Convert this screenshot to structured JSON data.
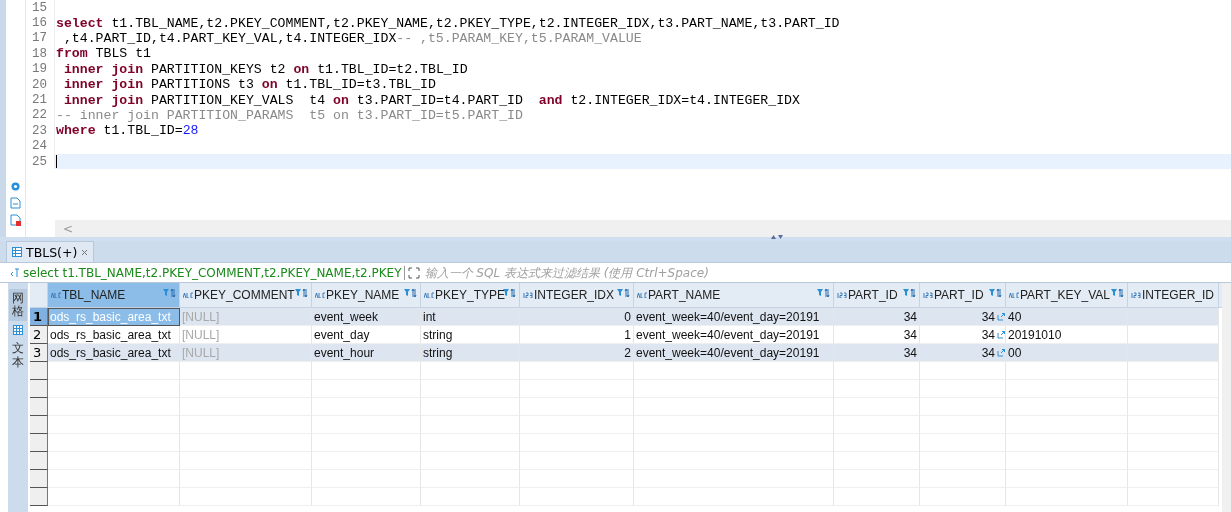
{
  "editor": {
    "lines": [
      {
        "number": "15",
        "current": false
      },
      {
        "number": "16",
        "current": false,
        "tokens": [
          {
            "kind": "keyword",
            "text": "select"
          },
          {
            "kind": "plain",
            "text": " t1.TBL_NAME,t2.PKEY_COMMENT,t2.PKEY_NAME,t2.PKEY_TYPE,t2.INTEGER_IDX,t3.PART_NAME,t3.PART_ID"
          }
        ]
      },
      {
        "number": "17",
        "current": false,
        "tokens": [
          {
            "kind": "plain",
            "text": " ,t4.PART_ID,t4.PART_KEY_VAL,t4.INTEGER_IDX"
          },
          {
            "kind": "comment",
            "text": "-- ,t5.PARAM_KEY,t5.PARAM_VALUE"
          }
        ]
      },
      {
        "number": "18",
        "current": false,
        "tokens": [
          {
            "kind": "keyword",
            "text": "from"
          },
          {
            "kind": "plain",
            "text": " TBLS t1"
          }
        ]
      },
      {
        "number": "19",
        "current": false,
        "tokens": [
          {
            "kind": "keyword",
            "text": " inner join"
          },
          {
            "kind": "plain",
            "text": " PARTITION_KEYS t2 "
          },
          {
            "kind": "keyword",
            "text": "on"
          },
          {
            "kind": "plain",
            "text": " t1.TBL_ID=t2.TBL_ID"
          }
        ]
      },
      {
        "number": "20",
        "current": false,
        "tokens": [
          {
            "kind": "keyword",
            "text": " inner join"
          },
          {
            "kind": "plain",
            "text": " PARTITIONS t3 "
          },
          {
            "kind": "keyword",
            "text": "on"
          },
          {
            "kind": "plain",
            "text": " t1.TBL_ID=t3.TBL_ID"
          }
        ]
      },
      {
        "number": "21",
        "current": false,
        "tokens": [
          {
            "kind": "keyword",
            "text": " inner join"
          },
          {
            "kind": "plain",
            "text": " PARTITION_KEY_VALS  t4 "
          },
          {
            "kind": "keyword",
            "text": "on"
          },
          {
            "kind": "plain",
            "text": " t3.PART_ID=t4.PART_ID  "
          },
          {
            "kind": "keyword",
            "text": "and"
          },
          {
            "kind": "plain",
            "text": " t2.INTEGER_IDX=t4.INTEGER_IDX"
          }
        ]
      },
      {
        "number": "22",
        "current": false,
        "tokens": [
          {
            "kind": "comment",
            "text": "-- inner join PARTITION_PARAMS  t5 on t3.PART_ID=t5.PART_ID"
          }
        ]
      },
      {
        "number": "23",
        "current": false,
        "tokens": [
          {
            "kind": "keyword",
            "text": "where"
          },
          {
            "kind": "plain",
            "text": " t1.TBL_ID="
          },
          {
            "kind": "number",
            "text": "28"
          }
        ]
      },
      {
        "number": "24",
        "current": false
      },
      {
        "number": "25",
        "current": true
      }
    ],
    "scroll_left": "<"
  },
  "results": {
    "tab": {
      "label": "TBLS(+)",
      "selected": true
    },
    "query": "select t1.TBL_NAME,t2.PKEY_COMMENT,t2.PKEY_NAME,t2.PKEY",
    "filter": {
      "placeholder": "输入一个 SQL 表达式来过滤结果 (使用 Ctrl+Space)"
    },
    "side_tabs": [
      {
        "label": "网格",
        "selected": true
      },
      {
        "label": "文本",
        "selected": false
      }
    ],
    "columns": [
      {
        "label": "TBL_NAME",
        "kind": "text",
        "link": false,
        "selected": true
      },
      {
        "label": "PKEY_COMMENT",
        "kind": "text",
        "link": false,
        "selected": false
      },
      {
        "label": "PKEY_NAME",
        "kind": "text",
        "link": false,
        "selected": false
      },
      {
        "label": "PKEY_TYPE",
        "kind": "text",
        "link": false,
        "selected": false
      },
      {
        "label": "INTEGER_IDX",
        "kind": "number",
        "link": false,
        "selected": false
      },
      {
        "label": "PART_NAME",
        "kind": "text",
        "link": false,
        "selected": false
      },
      {
        "label": "PART_ID",
        "kind": "number",
        "link": false,
        "selected": false
      },
      {
        "label": "PART_ID",
        "kind": "number",
        "link": true,
        "selected": false
      },
      {
        "label": "PART_KEY_VAL",
        "kind": "text",
        "link": false,
        "selected": false
      },
      {
        "label": "INTEGER_ID",
        "kind": "number",
        "link": false,
        "selected": false
      }
    ],
    "rows": [
      {
        "number": "1",
        "selected": true,
        "cells": [
          "ods_rs_basic_area_txt",
          "[NULL]",
          "event_week",
          "int",
          "0",
          "event_week=40/event_day=20191",
          "34",
          "34",
          "40",
          null
        ]
      },
      {
        "number": "2",
        "selected": false,
        "cells": [
          "ods_rs_basic_area_txt",
          "[NULL]",
          "event_day",
          "string",
          "1",
          "event_week=40/event_day=20191",
          "34",
          "34",
          "20191010",
          null
        ]
      },
      {
        "number": "3",
        "selected": false,
        "cells": [
          "ods_rs_basic_area_txt",
          "[NULL]",
          "event_hour",
          "string",
          "2",
          "event_week=40/event_day=20191",
          "34",
          "34",
          "00",
          null
        ]
      }
    ]
  }
}
